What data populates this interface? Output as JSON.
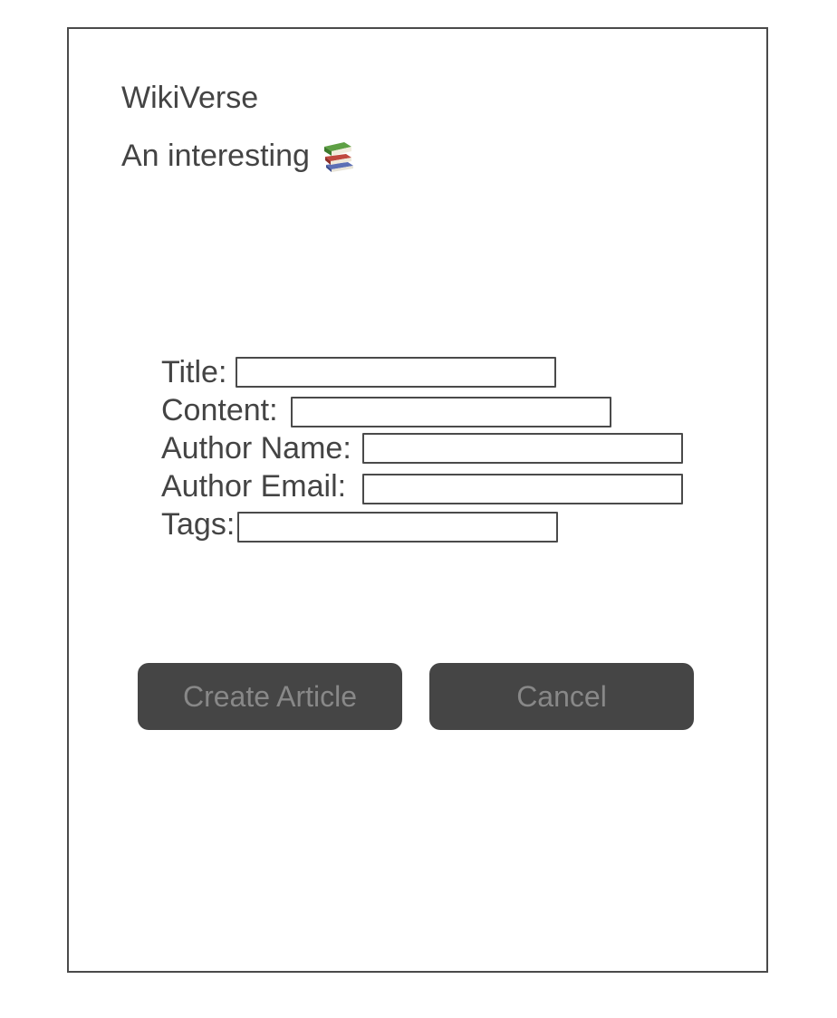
{
  "header": {
    "title": "WikiVerse",
    "tagline": "An interesting",
    "tagline_icon": "books-icon"
  },
  "form": {
    "fields": [
      {
        "label": "Title:",
        "value": "",
        "placeholder": ""
      },
      {
        "label": "Content:",
        "value": "",
        "placeholder": ""
      },
      {
        "label": "Author Name:",
        "value": "",
        "placeholder": ""
      },
      {
        "label": "Author Email:",
        "value": "",
        "placeholder": ""
      },
      {
        "label": "Tags:",
        "value": "",
        "placeholder": ""
      }
    ]
  },
  "actions": {
    "create_label": "Create Article",
    "cancel_label": "Cancel"
  },
  "colors": {
    "border": "#4a4a4a",
    "text": "#444444",
    "button_bg": "#454545",
    "button_text": "#888888"
  }
}
